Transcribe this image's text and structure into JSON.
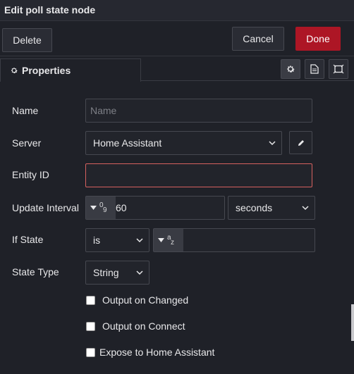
{
  "dialog": {
    "title": "Edit poll state node"
  },
  "toolbar": {
    "delete_label": "Delete",
    "cancel_label": "Cancel",
    "done_label": "Done",
    "done_color": "#ad1625"
  },
  "tabs": {
    "properties_label": "Properties"
  },
  "form": {
    "name": {
      "label": "Name",
      "placeholder": "Name",
      "value": ""
    },
    "server": {
      "label": "Server",
      "value": "Home Assistant"
    },
    "entity_id": {
      "label": "Entity ID",
      "value": ""
    },
    "update_interval": {
      "label": "Update Interval",
      "type_top": "0",
      "type_bot": "9",
      "value": "60",
      "unit": "seconds"
    },
    "if_state": {
      "label": "If State",
      "operator": "is",
      "type_top": "a",
      "type_bot": "z",
      "value": ""
    },
    "state_type": {
      "label": "State Type",
      "value": "String"
    },
    "checkboxes": [
      {
        "label": "Output on Changed",
        "checked": false
      },
      {
        "label": "Output on Connect",
        "checked": false
      },
      {
        "label": "Expose to Home Assistant",
        "checked": false
      }
    ]
  },
  "icons": [
    "gear-icon",
    "pencil-icon",
    "document-icon",
    "frame-icon",
    "chevron-down-icon",
    "caret-down-icon"
  ]
}
